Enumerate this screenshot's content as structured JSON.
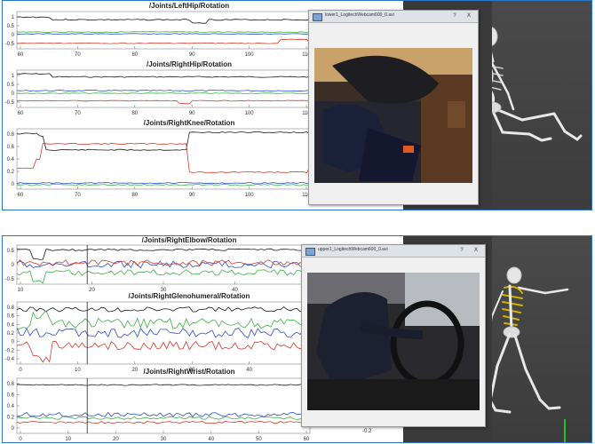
{
  "top": {
    "charts": [
      {
        "title": "/Joints/LeftHip/Rotation",
        "yticks": [
          "1",
          "0.5",
          "0",
          "-0.5"
        ],
        "xticks": [
          "60",
          "70",
          "80",
          "90",
          "100",
          "110"
        ]
      },
      {
        "title": "/Joints/RightHip/Rotation",
        "yticks": [
          "1",
          "0.5",
          "0",
          "-0.5"
        ],
        "xticks": [
          "60",
          "70",
          "80",
          "90",
          "100",
          "110"
        ]
      },
      {
        "title": "/Joints/RightKnee/Rotation",
        "yticks": [
          "0.8",
          "0.6",
          "0.4",
          "0.2",
          "0"
        ],
        "xticks": [
          "60",
          "70",
          "80",
          "90",
          "100",
          "110"
        ]
      }
    ],
    "video_title": "lower1_LogitechWebcam600_0.avi"
  },
  "bottom": {
    "charts": [
      {
        "title": "/Joints/RightElbow/Rotation",
        "yticks": [
          "0.5",
          "0",
          "-0.5"
        ],
        "xticks": [
          "10",
          "20",
          "30",
          "40",
          "50"
        ]
      },
      {
        "title": "/Joints/RightGlenohumeral/Rotation",
        "yticks": [
          "0.8",
          "0.6",
          "0.4",
          "0.2",
          "0",
          "-0.2",
          "-0.4"
        ],
        "xticks": [
          "0",
          "10",
          "20",
          "30",
          "40",
          "50"
        ]
      },
      {
        "title": "/Joints/RightWrist/Rotation",
        "yticks": [
          "0.8",
          "0.6",
          "0.4",
          "0.2",
          "0"
        ],
        "xticks": [
          "0",
          "10",
          "20",
          "30",
          "40",
          "50",
          "60"
        ]
      }
    ],
    "video_title": "upper1_LogitechWebcam600_0.avi",
    "extra_label": "-0.2"
  },
  "window_buttons": {
    "help": "?",
    "close": "X"
  },
  "colors": {
    "black": "#1a1a1a",
    "red": "#d33b2c",
    "green": "#3cb043",
    "blue": "#2b4fc0",
    "accent": "#2a76c6"
  }
}
